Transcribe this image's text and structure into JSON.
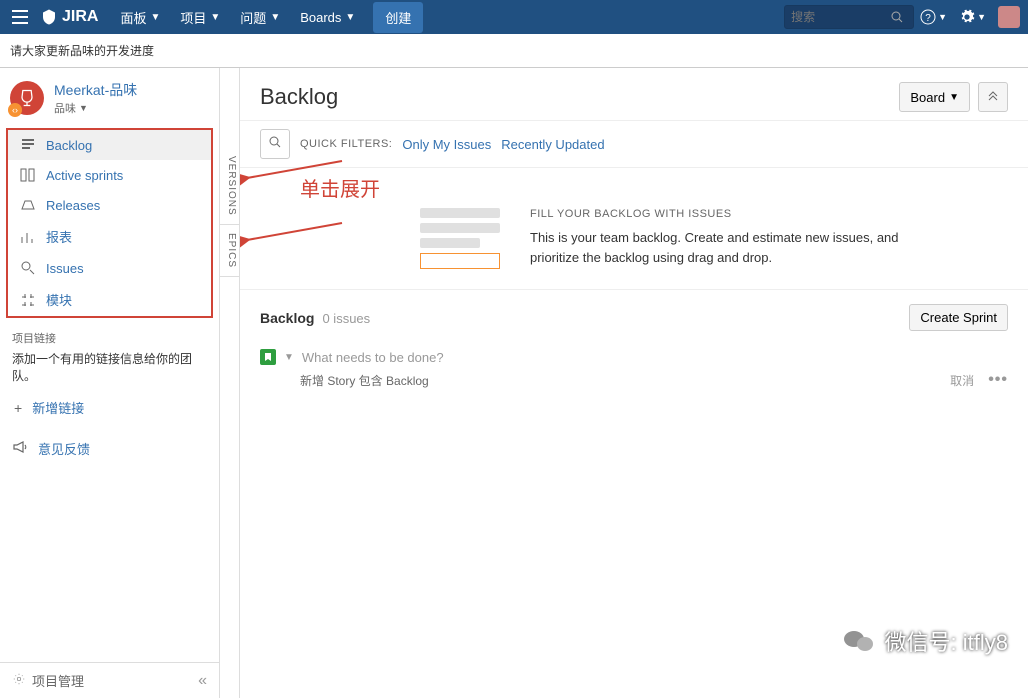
{
  "topnav": {
    "logo": "JIRA",
    "items": [
      "面板",
      "项目",
      "问题",
      "Boards"
    ],
    "create": "创建",
    "search_placeholder": "搜索"
  },
  "notice": "请大家更新品味的开发进度",
  "project": {
    "name": "Meerkat-品味",
    "type": "品味"
  },
  "sidebar": {
    "items": [
      {
        "label": "Backlog"
      },
      {
        "label": "Active sprints"
      },
      {
        "label": "Releases"
      },
      {
        "label": "报表"
      },
      {
        "label": "Issues"
      },
      {
        "label": "模块"
      }
    ],
    "links_title": "项目链接",
    "links_desc": "添加一个有用的链接信息给你的团队。",
    "add_link": "新增链接",
    "feedback": "意见反馈",
    "proj_mgmt": "项目管理"
  },
  "vtabs": {
    "versions": "VERSIONS",
    "epics": "EPICS"
  },
  "main": {
    "title": "Backlog",
    "board_btn": "Board",
    "quick_filters_label": "QUICK FILTERS:",
    "filters": [
      "Only My Issues",
      "Recently Updated"
    ],
    "empty_title": "FILL YOUR BACKLOG WITH ISSUES",
    "empty_desc": "This is your team backlog. Create and estimate new issues, and prioritize the backlog using drag and drop.",
    "backlog_label": "Backlog",
    "backlog_count": "0 issues",
    "create_sprint": "Create Sprint",
    "create_placeholder": "What needs to be done?",
    "create_hint": "新增 Story 包含 Backlog",
    "cancel": "取消"
  },
  "annotation": {
    "click_expand": "单击展开"
  },
  "watermark": "微信号: itfly8"
}
